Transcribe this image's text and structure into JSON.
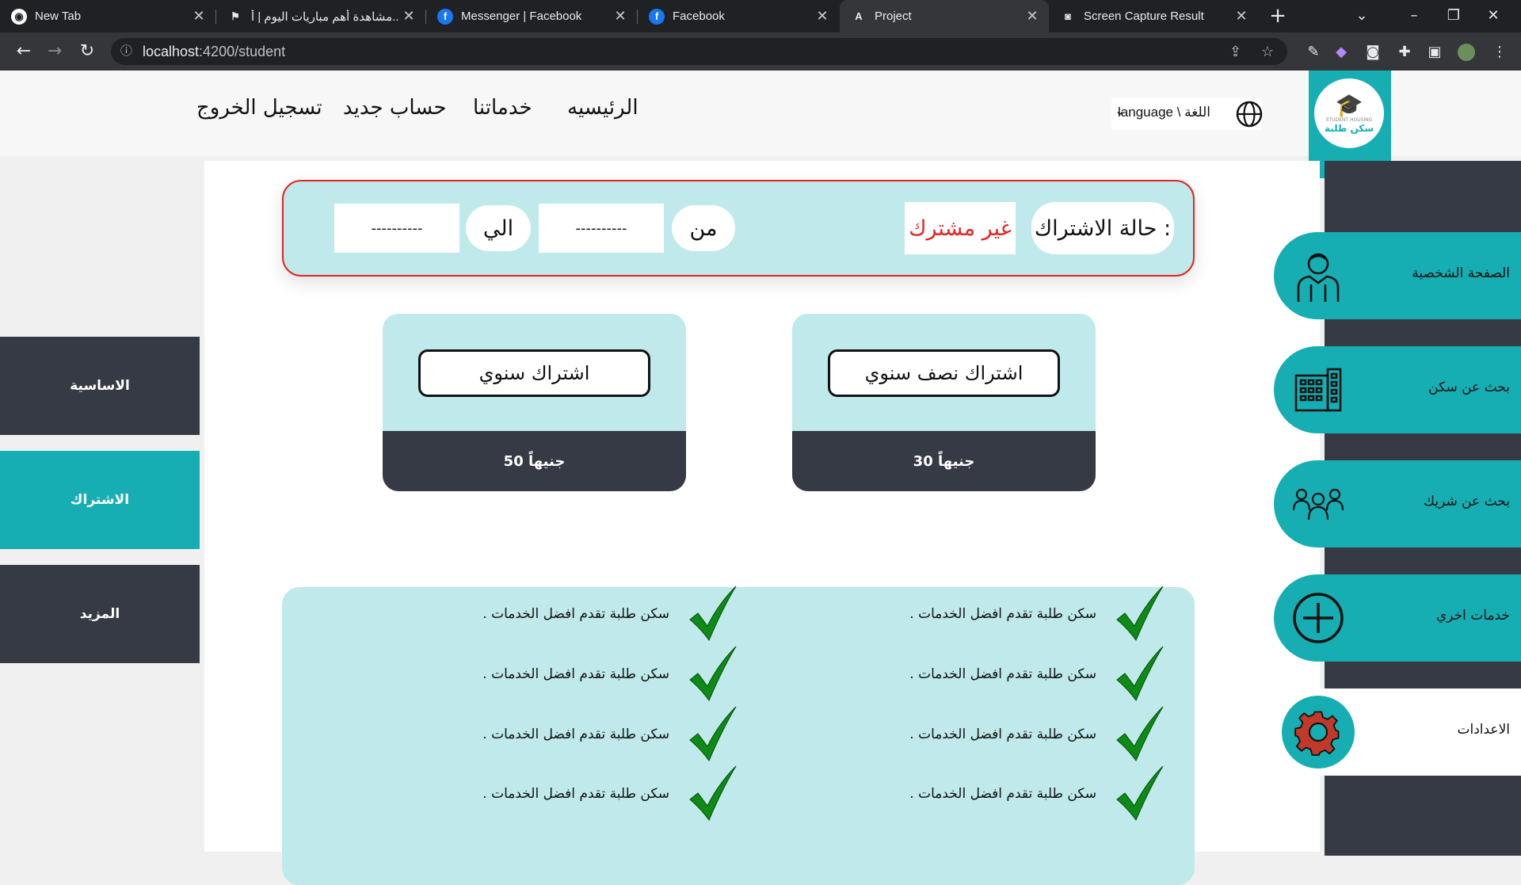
{
  "browser": {
    "tabs": [
      {
        "title": "New Tab",
        "icon": "chrome-icon"
      },
      {
        "title": "مشاهدة أهم مباريات اليوم | أ...",
        "icon": "site-icon"
      },
      {
        "title": "Messenger | Facebook",
        "icon": "facebook-icon"
      },
      {
        "title": "Facebook",
        "icon": "facebook-icon"
      },
      {
        "title": "Project",
        "icon": "angular-icon"
      },
      {
        "title": "Screen Capture Result",
        "icon": "camera-icon"
      }
    ],
    "url_host": "localhost",
    "url_path": ":4200/student"
  },
  "nav": {
    "home": "الرئيسيه",
    "services": "خدماتنا",
    "new_account": "حساب جديد",
    "logout": "تسجيل الخروج",
    "language": "اللغة \\ language"
  },
  "logo": {
    "text": "سكن طلبة",
    "small": "STUDENT HOUSING"
  },
  "left_sidebar": [
    {
      "label": "الاساسية"
    },
    {
      "label": "الاشتراك"
    },
    {
      "label": "المزيد"
    }
  ],
  "subscription": {
    "status_label": "حالة الاشتراك :",
    "status_value": "غير مشترك",
    "from_label": "من",
    "from_value": "----------",
    "to_label": "الي",
    "to_value": "----------"
  },
  "plans": [
    {
      "name": "اشتراك نصف سنوي",
      "price": "30 جنيهاً"
    },
    {
      "name": "اشتراك سنوي",
      "price": "50 جنيهاً"
    }
  ],
  "features": {
    "right": [
      "سكن طلبة تقدم افضل الخدمات .",
      "سكن طلبة تقدم افضل الخدمات .",
      "سكن طلبة تقدم افضل الخدمات .",
      "سكن طلبة تقدم افضل الخدمات ."
    ],
    "left": [
      "سكن طلبة تقدم افضل الخدمات .",
      "سكن طلبة تقدم افضل الخدمات .",
      "سكن طلبة تقدم افضل الخدمات .",
      "سكن طلبة تقدم افضل الخدمات ."
    ]
  },
  "right_sidebar": [
    {
      "label": "الصفحة الشخصية",
      "icon": "user-icon"
    },
    {
      "label": "بحث عن سكن",
      "icon": "building-icon"
    },
    {
      "label": "بحث عن شريك",
      "icon": "group-icon"
    },
    {
      "label": "خدمات اخري",
      "icon": "plus-circle-icon"
    },
    {
      "label": "الاعدادات",
      "icon": "gear-icon"
    }
  ],
  "colors": {
    "teal": "#17aeb3",
    "dark": "#363a44",
    "light_teal": "#bfe9ea",
    "red": "#e32525",
    "check_green": "#0e8a16"
  }
}
